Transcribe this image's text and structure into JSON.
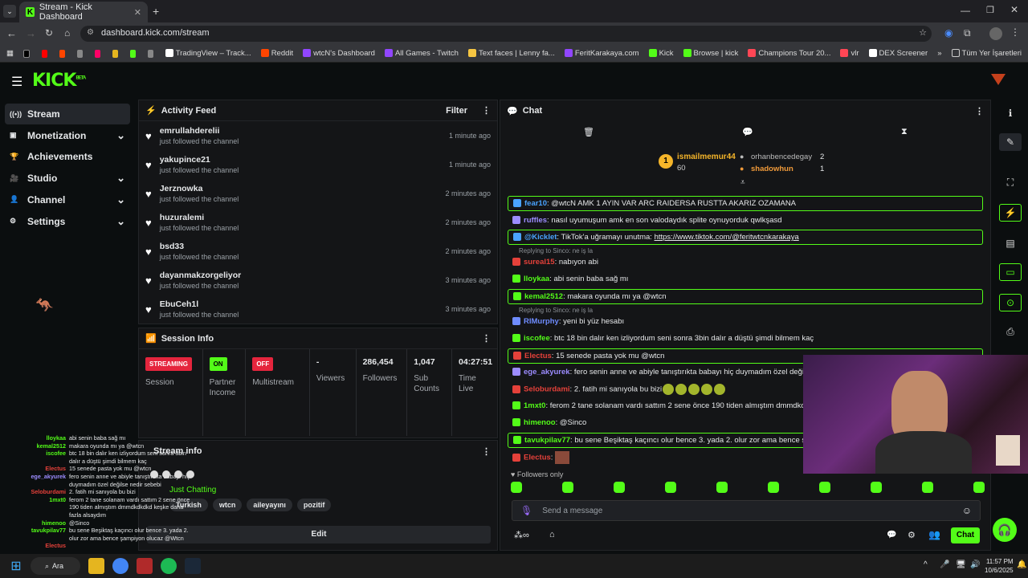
{
  "browser": {
    "tab_title": "Stream - Kick Dashboard",
    "url": "dashboard.kick.com/stream",
    "bookmarks": [
      {
        "label": "TradingView – Track...",
        "color": "#ffffff"
      },
      {
        "label": "Reddit",
        "color": "#ff4500"
      },
      {
        "label": "wtcN's Dashboard",
        "color": "#9146ff"
      },
      {
        "label": "All Games - Twitch",
        "color": "#9146ff"
      },
      {
        "label": "Text faces | Lenny fa...",
        "color": "#f5c542"
      },
      {
        "label": "FeritKarakaya.com",
        "color": "#9146ff"
      },
      {
        "label": "Kick",
        "color": "#53fc18"
      },
      {
        "label": "Browse | kick",
        "color": "#53fc18"
      },
      {
        "label": "Champions Tour 20...",
        "color": "#ff4655"
      },
      {
        "label": "vlr",
        "color": "#ff4655"
      },
      {
        "label": "DEX Screener",
        "color": "#ffffff"
      }
    ],
    "bookmarks_folder": "Tüm Yer İşaretleri"
  },
  "app": {
    "logo": "KICK",
    "logo_tag": "BETA"
  },
  "sidebar": {
    "items": [
      {
        "label": "Stream",
        "icon": "broadcast-icon",
        "chevron": false
      },
      {
        "label": "Monetization",
        "icon": "money-icon",
        "chevron": true
      },
      {
        "label": "Achievements",
        "icon": "trophy-icon",
        "chevron": false
      },
      {
        "label": "Studio",
        "icon": "studio-icon",
        "chevron": true
      },
      {
        "label": "Channel",
        "icon": "channel-icon",
        "chevron": true
      },
      {
        "label": "Settings",
        "icon": "gear-icon",
        "chevron": true
      }
    ]
  },
  "activity": {
    "title": "Activity Feed",
    "filter": "Filter",
    "items": [
      {
        "name": "emrullahderelii",
        "action": "just followed the channel",
        "time": "1 minute ago"
      },
      {
        "name": "yakupince21",
        "action": "just followed the channel",
        "time": "1 minute ago"
      },
      {
        "name": "Jerznowka",
        "action": "just followed the channel",
        "time": "2 minutes ago"
      },
      {
        "name": "huzuralemi",
        "action": "just followed the channel",
        "time": "2 minutes ago"
      },
      {
        "name": "bsd33",
        "action": "just followed the channel",
        "time": "2 minutes ago"
      },
      {
        "name": "dayanmakzorgeliyor",
        "action": "just followed the channel",
        "time": "3 minutes ago"
      },
      {
        "name": "EbuCeh1l",
        "action": "just followed the channel",
        "time": "3 minutes ago"
      }
    ]
  },
  "session": {
    "title": "Session Info",
    "streaming": "STREAMING",
    "session_label": "Session",
    "partner_badge": "ON",
    "partner_label": "Partner Income",
    "multistream_badge": "OFF",
    "multistream_label": "Multistream",
    "viewers_value": "-",
    "viewers_label": "Viewers",
    "followers_value": "286,454",
    "followers_label": "Followers",
    "subs_value": "1,047",
    "subs_label": "Sub Counts",
    "time_value": "04:27:51",
    "time_label": "Time Live"
  },
  "stream_info": {
    "title": "Stream info",
    "category": "Just Chatting",
    "tags": [
      "Turkish",
      "wtcn",
      "aileyayını",
      "pozitif"
    ],
    "edit": "Edit"
  },
  "chat": {
    "title": "Chat",
    "leaderboard": {
      "top_rank": "1",
      "top_name": "ismailmemur44",
      "top_count": "60",
      "second_name": "orhanbencedegay",
      "second_count": "2",
      "third_name": "shadowhun",
      "third_count": "1"
    },
    "messages": [
      {
        "user": "fear10",
        "color": "#4aa3ff",
        "text": "@wtcN AMK 1 AYIN VAR ARC RAIDERSA RUSTTA AKARIZ OZAMANA",
        "highlight": true
      },
      {
        "user": "ruffles",
        "color": "#9c8cff",
        "text": "nasıl uyumuşum amk en son valodaydık splite oynuyorduk qwlkşasd",
        "highlight": false
      },
      {
        "user": "@Kicklet",
        "color": "#4aa3ff",
        "text": "TikTok'a uğramayı unutma: ",
        "link": "https://www.tiktok.com/@feritwtcnkarakaya",
        "highlight": true
      },
      {
        "user": "sureal15",
        "color": "#e5413a",
        "text": "nabıyon abi",
        "highlight": false,
        "reply": "Replying to Sinco: ne iş la"
      },
      {
        "user": "lloykaa",
        "color": "#53fc18",
        "text": "abi senin baba sağ mı",
        "highlight": false
      },
      {
        "user": "kemal2512",
        "color": "#53fc18",
        "text": "makara oyunda mı ya @wtcn",
        "highlight": true
      },
      {
        "user": "RIMurphy",
        "color": "#6f8cff",
        "text": "yeni bi yüz hesabı",
        "highlight": false,
        "reply": "Replying to Sinco: ne iş la"
      },
      {
        "user": "iscofee",
        "color": "#53fc18",
        "text": "btc 18 bin dalır ken izliyordum seni sonra 3bin dalır a düştü şimdi bilmem kaç",
        "highlight": false
      },
      {
        "user": "Electus",
        "color": "#e5413a",
        "text": "15 senede pasta yok mu @wtcn",
        "highlight": true
      },
      {
        "user": "ege_akyurek",
        "color": "#9c8cff",
        "text": "fero senin anne ve abiyle tanıştırıkta babayı hiç duymadım özel değilse nedir sebebi",
        "highlight": false
      },
      {
        "user": "Seloburdami",
        "color": "#e5413a",
        "text": "2. fatih mi sanıyola bu bizi",
        "highlight": false,
        "emotes": 5
      },
      {
        "user": "1mxt0",
        "color": "#53fc18",
        "text": "ferom 2 tane solanam vardı sattım 2 sene önce 190 tiden almıştım dmmdkdkdkd keşke daha fazla alsaydım",
        "highlight": false
      },
      {
        "user": "himenoo",
        "color": "#53fc18",
        "text": "@Sinco",
        "highlight": false
      },
      {
        "user": "tavukpilav77",
        "color": "#53fc18",
        "text": "bu sene Beşiktaş kaçıncı olur bence 3. yada 2. olur zor ama bence şampiyon olucaz @wtcn",
        "highlight": true
      },
      {
        "user": "Electus",
        "color": "#e5413a",
        "text": "",
        "highlight": false
      }
    ],
    "followers_only": "Followers only",
    "input_placeholder": "Send a message",
    "send": "Chat"
  },
  "overlay": {
    "messages": [
      {
        "user": "lloykaa",
        "color": "#53fc18",
        "text": "abi senin baba sağ mı"
      },
      {
        "user": "kemal2512",
        "color": "#53fc18",
        "text": "makara oyunda mı ya @wtcn"
      },
      {
        "user": "iscofee",
        "color": "#53fc18",
        "text": "btc 18 bin dalır ken izliyordum seni sonra 3bin"
      },
      {
        "user": "",
        "color": "#53fc18",
        "text": "dalır a düştü şimdi bilmem kaç"
      },
      {
        "user": "Electus",
        "color": "#e5413a",
        "text": "15 senede pasta yok mu @wtcn"
      },
      {
        "user": "ege_akyurek",
        "color": "#9c8cff",
        "text": "fero senin anne ve abiyle tanıştırıkta babayı hiç"
      },
      {
        "user": "",
        "color": "#9c8cff",
        "text": "duymadım özel değilse nedir sebebi"
      },
      {
        "user": "Seloburdami",
        "color": "#e5413a",
        "text": "2. fatih mi sanıyola bu bizi"
      },
      {
        "user": "1mxt0",
        "color": "#53fc18",
        "text": "ferom 2 tane solanam vardı sattım 2 sene önce"
      },
      {
        "user": "",
        "color": "#53fc18",
        "text": "190 tiden almıştım dmmdkdkdkd keşke daha"
      },
      {
        "user": "",
        "color": "#53fc18",
        "text": "fazla alsaydım"
      },
      {
        "user": "himenoo",
        "color": "#53fc18",
        "text": "@Sinco"
      },
      {
        "user": "tavukpilav77",
        "color": "#53fc18",
        "text": "bu sene Beşiktaş kaçıncı olur bence 3. yada 2."
      },
      {
        "user": "",
        "color": "#53fc18",
        "text": "olur zor ama bence şampiyon olucaz @Wtcn"
      },
      {
        "user": "Electus",
        "color": "#e5413a",
        "text": ""
      }
    ]
  },
  "taskbar": {
    "search_label": "Ara",
    "time": "11:57 PM",
    "date": "10/6/2025"
  }
}
